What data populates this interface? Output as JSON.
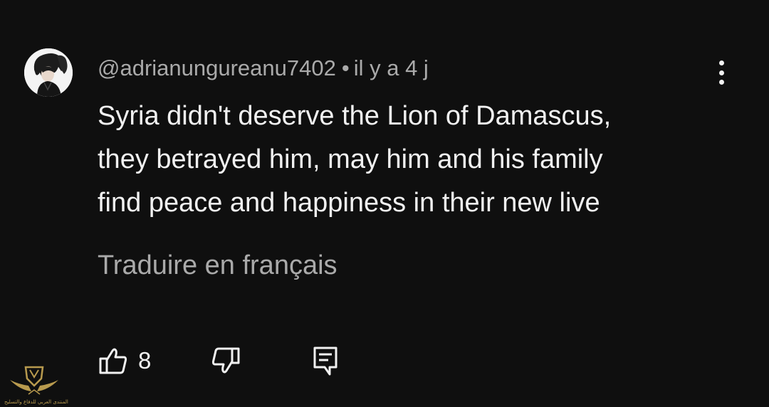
{
  "comment": {
    "author": "@adrianungureanu7402",
    "separator": "•",
    "timestamp": "il y a 4 j",
    "text_lines": [
      "Syria didn't deserve the Lion of Damascus,",
      "they betrayed him, may him and his family",
      "find peace and happiness in their new live"
    ],
    "translate_label": "Traduire en français",
    "like_count": "8"
  },
  "icons": {
    "menu": "more-vert-icon",
    "like": "thumb-up-icon",
    "dislike": "thumb-down-icon",
    "reply": "reply-comment-icon"
  },
  "watermark": {
    "text": "المنتدى العربي للدفاع والتسليح"
  },
  "colors": {
    "background": "#0f0f0f",
    "primary_text": "#f1f1f1",
    "secondary_text": "#aaaaaa",
    "watermark_gold": "#b89a4e"
  }
}
